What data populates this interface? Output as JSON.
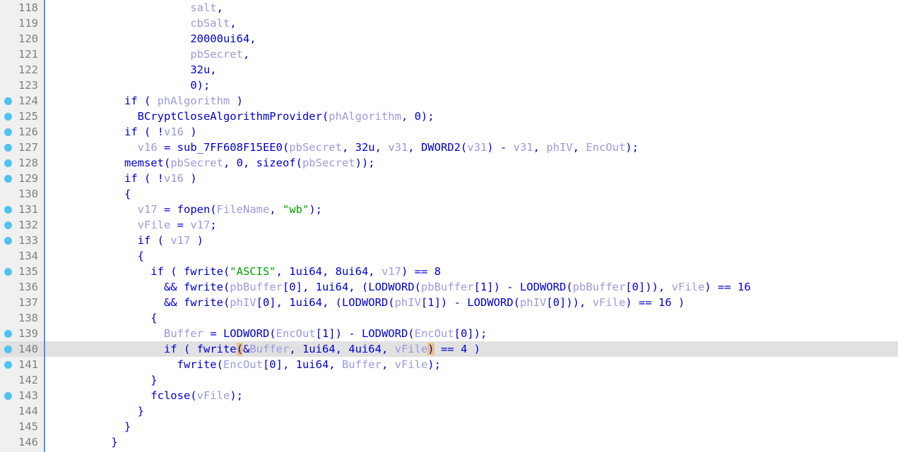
{
  "app": {
    "view": "hex-rays-pseudocode",
    "theme_background": "#ffffff",
    "gutter_background": "#f0f0f0",
    "gutter_separator_color": "#5f8fd0",
    "current_line_highlight": "#e1e1e1",
    "breakpoint_color": "#4ec3f0",
    "paren_match_highlight": "#e8c382",
    "keyword_color": "#0000d0",
    "variable_color": "#9a9ae0",
    "string_color": "#00a000",
    "lineno_color": "#808080"
  },
  "editor": {
    "current_line": 140,
    "first_visible_line": 118,
    "last_visible_line": 146
  },
  "lines": [
    {
      "number": "118",
      "breakpoint": false,
      "current": false,
      "tokens": [
        {
          "t": "                      ",
          "c": "k"
        },
        {
          "t": "salt",
          "c": "var"
        },
        {
          "t": ",",
          "c": "k"
        }
      ]
    },
    {
      "number": "119",
      "breakpoint": false,
      "current": false,
      "tokens": [
        {
          "t": "                      ",
          "c": "k"
        },
        {
          "t": "cbSalt",
          "c": "var"
        },
        {
          "t": ",",
          "c": "k"
        }
      ]
    },
    {
      "number": "120",
      "breakpoint": false,
      "current": false,
      "tokens": [
        {
          "t": "                      ",
          "c": "k"
        },
        {
          "t": "20000ui64,",
          "c": "k"
        }
      ]
    },
    {
      "number": "121",
      "breakpoint": false,
      "current": false,
      "tokens": [
        {
          "t": "                      ",
          "c": "k"
        },
        {
          "t": "pbSecret",
          "c": "var"
        },
        {
          "t": ",",
          "c": "k"
        }
      ]
    },
    {
      "number": "122",
      "breakpoint": false,
      "current": false,
      "tokens": [
        {
          "t": "                      ",
          "c": "k"
        },
        {
          "t": "32u,",
          "c": "k"
        }
      ]
    },
    {
      "number": "123",
      "breakpoint": false,
      "current": false,
      "tokens": [
        {
          "t": "                      ",
          "c": "k"
        },
        {
          "t": "0);",
          "c": "k"
        }
      ]
    },
    {
      "number": "124",
      "breakpoint": true,
      "current": false,
      "tokens": [
        {
          "t": "            if ( ",
          "c": "k"
        },
        {
          "t": "phAlgorithm",
          "c": "var"
        },
        {
          "t": " )",
          "c": "k"
        }
      ]
    },
    {
      "number": "125",
      "breakpoint": true,
      "current": false,
      "tokens": [
        {
          "t": "              BCryptCloseAlgorithmProvider(",
          "c": "k"
        },
        {
          "t": "phAlgorithm",
          "c": "var"
        },
        {
          "t": ", 0);",
          "c": "k"
        }
      ]
    },
    {
      "number": "126",
      "breakpoint": true,
      "current": false,
      "tokens": [
        {
          "t": "            if ( !",
          "c": "k"
        },
        {
          "t": "v16",
          "c": "var"
        },
        {
          "t": " )",
          "c": "k"
        }
      ]
    },
    {
      "number": "127",
      "breakpoint": true,
      "current": false,
      "tokens": [
        {
          "t": "              ",
          "c": "k"
        },
        {
          "t": "v16",
          "c": "var"
        },
        {
          "t": " = sub_7FF608F15EE0(",
          "c": "k"
        },
        {
          "t": "pbSecret",
          "c": "var"
        },
        {
          "t": ", 32u, ",
          "c": "k"
        },
        {
          "t": "v31",
          "c": "var"
        },
        {
          "t": ", DWORD2(",
          "c": "k"
        },
        {
          "t": "v31",
          "c": "var"
        },
        {
          "t": ") - ",
          "c": "k"
        },
        {
          "t": "v31",
          "c": "var"
        },
        {
          "t": ", ",
          "c": "k"
        },
        {
          "t": "phIV",
          "c": "var"
        },
        {
          "t": ", ",
          "c": "k"
        },
        {
          "t": "EncOut",
          "c": "var"
        },
        {
          "t": ");",
          "c": "k"
        }
      ]
    },
    {
      "number": "128",
      "breakpoint": true,
      "current": false,
      "tokens": [
        {
          "t": "            memset(",
          "c": "k"
        },
        {
          "t": "pbSecret",
          "c": "var"
        },
        {
          "t": ", 0, sizeof(",
          "c": "k"
        },
        {
          "t": "pbSecret",
          "c": "var"
        },
        {
          "t": "));",
          "c": "k"
        }
      ]
    },
    {
      "number": "129",
      "breakpoint": true,
      "current": false,
      "tokens": [
        {
          "t": "            if ( !",
          "c": "k"
        },
        {
          "t": "v16",
          "c": "var"
        },
        {
          "t": " )",
          "c": "k"
        }
      ]
    },
    {
      "number": "130",
      "breakpoint": false,
      "current": false,
      "tokens": [
        {
          "t": "            {",
          "c": "k"
        }
      ]
    },
    {
      "number": "131",
      "breakpoint": true,
      "current": false,
      "tokens": [
        {
          "t": "              ",
          "c": "k"
        },
        {
          "t": "v17",
          "c": "var"
        },
        {
          "t": " = fopen(",
          "c": "k"
        },
        {
          "t": "FileName",
          "c": "var"
        },
        {
          "t": ", ",
          "c": "k"
        },
        {
          "t": "\"wb\"",
          "c": "str"
        },
        {
          "t": ");",
          "c": "k"
        }
      ]
    },
    {
      "number": "132",
      "breakpoint": true,
      "current": false,
      "tokens": [
        {
          "t": "              ",
          "c": "k"
        },
        {
          "t": "vFile",
          "c": "var"
        },
        {
          "t": " = ",
          "c": "k"
        },
        {
          "t": "v17",
          "c": "var"
        },
        {
          "t": ";",
          "c": "k"
        }
      ]
    },
    {
      "number": "133",
      "breakpoint": true,
      "current": false,
      "tokens": [
        {
          "t": "              if ( ",
          "c": "k"
        },
        {
          "t": "v17",
          "c": "var"
        },
        {
          "t": " )",
          "c": "k"
        }
      ]
    },
    {
      "number": "134",
      "breakpoint": false,
      "current": false,
      "tokens": [
        {
          "t": "              {",
          "c": "k"
        }
      ]
    },
    {
      "number": "135",
      "breakpoint": true,
      "current": false,
      "tokens": [
        {
          "t": "                if ( fwrite(",
          "c": "k"
        },
        {
          "t": "\"ASCIS\"",
          "c": "str"
        },
        {
          "t": ", 1ui64, 8ui64, ",
          "c": "k"
        },
        {
          "t": "v17",
          "c": "var"
        },
        {
          "t": ") == 8",
          "c": "k"
        }
      ]
    },
    {
      "number": "136",
      "breakpoint": false,
      "current": false,
      "tokens": [
        {
          "t": "                  && fwrite(",
          "c": "k"
        },
        {
          "t": "pbBuffer",
          "c": "var"
        },
        {
          "t": "[0], 1ui64, (LODWORD(",
          "c": "k"
        },
        {
          "t": "pbBuffer",
          "c": "var"
        },
        {
          "t": "[1]) - LODWORD(",
          "c": "k"
        },
        {
          "t": "pbBuffer",
          "c": "var"
        },
        {
          "t": "[0])), ",
          "c": "k"
        },
        {
          "t": "vFile",
          "c": "var"
        },
        {
          "t": ") == 16",
          "c": "k"
        }
      ]
    },
    {
      "number": "137",
      "breakpoint": false,
      "current": false,
      "tokens": [
        {
          "t": "                  && fwrite(",
          "c": "k"
        },
        {
          "t": "phIV",
          "c": "var"
        },
        {
          "t": "[0], 1ui64, (LODWORD(",
          "c": "k"
        },
        {
          "t": "phIV",
          "c": "var"
        },
        {
          "t": "[1]) - LODWORD(",
          "c": "k"
        },
        {
          "t": "phIV",
          "c": "var"
        },
        {
          "t": "[0])), ",
          "c": "k"
        },
        {
          "t": "vFile",
          "c": "var"
        },
        {
          "t": ") == 16 )",
          "c": "k"
        }
      ]
    },
    {
      "number": "138",
      "breakpoint": false,
      "current": false,
      "tokens": [
        {
          "t": "                {",
          "c": "k"
        }
      ]
    },
    {
      "number": "139",
      "breakpoint": true,
      "current": false,
      "tokens": [
        {
          "t": "                  ",
          "c": "k"
        },
        {
          "t": "Buffer",
          "c": "var"
        },
        {
          "t": " = LODWORD(",
          "c": "k"
        },
        {
          "t": "EncOut",
          "c": "var"
        },
        {
          "t": "[1]) - LODWORD(",
          "c": "k"
        },
        {
          "t": "EncOut",
          "c": "var"
        },
        {
          "t": "[0]);",
          "c": "k"
        }
      ]
    },
    {
      "number": "140",
      "breakpoint": true,
      "current": true,
      "tokens": [
        {
          "t": "                  if ( fwrite",
          "c": "k"
        },
        {
          "t": "(",
          "c": "paren-hl"
        },
        {
          "t": "&",
          "c": "k"
        },
        {
          "t": "Buffer",
          "c": "var"
        },
        {
          "t": ", 1ui64, 4ui64, ",
          "c": "k"
        },
        {
          "t": "vFile",
          "c": "var"
        },
        {
          "t": ")",
          "c": "paren-hl"
        },
        {
          "t": " == 4 )",
          "c": "k"
        }
      ]
    },
    {
      "number": "141",
      "breakpoint": true,
      "current": false,
      "tokens": [
        {
          "t": "                    fwrite(",
          "c": "k"
        },
        {
          "t": "EncOut",
          "c": "var"
        },
        {
          "t": "[0], 1ui64, ",
          "c": "k"
        },
        {
          "t": "Buffer",
          "c": "var"
        },
        {
          "t": ", ",
          "c": "k"
        },
        {
          "t": "vFile",
          "c": "var"
        },
        {
          "t": ");",
          "c": "k"
        }
      ]
    },
    {
      "number": "142",
      "breakpoint": false,
      "current": false,
      "tokens": [
        {
          "t": "                }",
          "c": "k"
        }
      ]
    },
    {
      "number": "143",
      "breakpoint": true,
      "current": false,
      "tokens": [
        {
          "t": "                fclose(",
          "c": "k"
        },
        {
          "t": "vFile",
          "c": "var"
        },
        {
          "t": ");",
          "c": "k"
        }
      ]
    },
    {
      "number": "144",
      "breakpoint": false,
      "current": false,
      "tokens": [
        {
          "t": "              }",
          "c": "k"
        }
      ]
    },
    {
      "number": "145",
      "breakpoint": false,
      "current": false,
      "tokens": [
        {
          "t": "            }",
          "c": "k"
        }
      ]
    },
    {
      "number": "146",
      "breakpoint": false,
      "current": false,
      "tokens": [
        {
          "t": "          }",
          "c": "k"
        }
      ]
    }
  ]
}
